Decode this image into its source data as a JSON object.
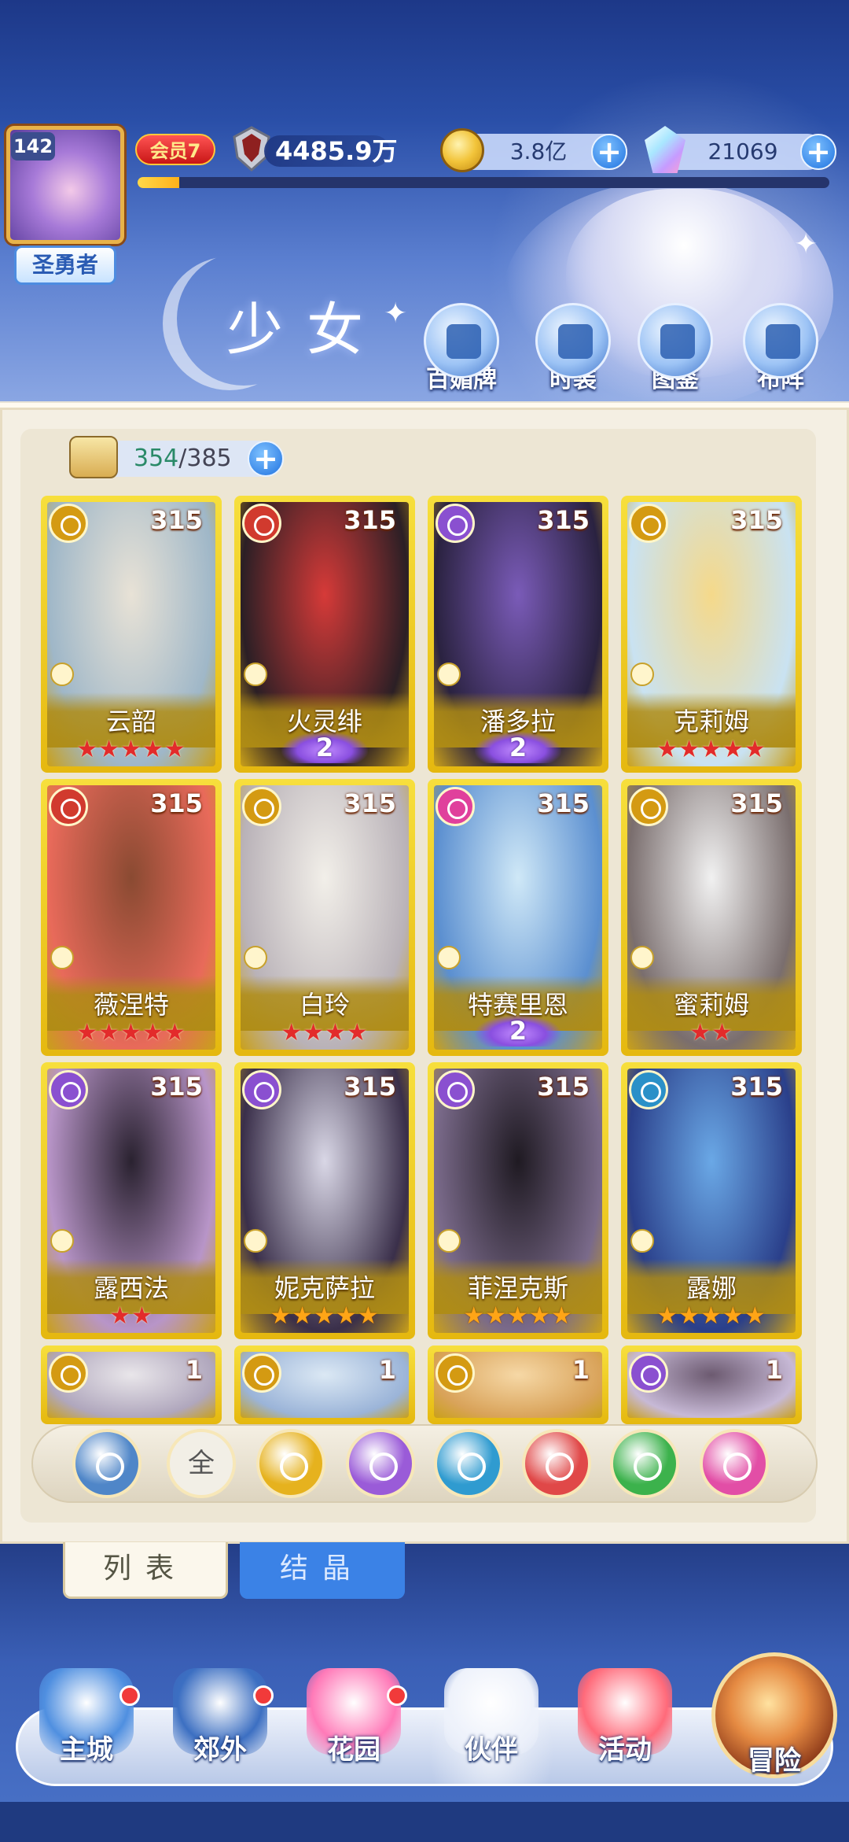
{
  "player": {
    "level": "142",
    "title": "圣勇者",
    "vip": "会员7",
    "power": "4485.9万",
    "exp_fraction": 0.06
  },
  "currency": {
    "gold": "3.8亿",
    "gems": "21069"
  },
  "section": {
    "title": "少女"
  },
  "features": [
    {
      "label": "百媚牌",
      "icon": "card-icon"
    },
    {
      "label": "时装",
      "icon": "outfit-icon"
    },
    {
      "label": "图鉴",
      "icon": "book-icon"
    },
    {
      "label": "布阵",
      "icon": "formation-grid-icon"
    }
  ],
  "roster": {
    "current": "354",
    "total": "385",
    "separator": "/"
  },
  "cards": [
    {
      "name": "云韶",
      "level": "315",
      "element": "light",
      "stars": "★★★★★",
      "star_color": "red"
    },
    {
      "name": "火灵绯",
      "level": "315",
      "element": "fire",
      "wing": "2"
    },
    {
      "name": "潘多拉",
      "level": "315",
      "element": "moon",
      "wing": "2"
    },
    {
      "name": "克莉姆",
      "level": "315",
      "element": "light",
      "stars": "★★★★★",
      "star_color": "red"
    },
    {
      "name": "薇涅特",
      "level": "315",
      "element": "fire",
      "stars": "★★★★★",
      "star_color": "red"
    },
    {
      "name": "白玲",
      "level": "315",
      "element": "light",
      "stars": "★★★★",
      "star_color": "red"
    },
    {
      "name": "特赛里恩",
      "level": "315",
      "element": "heart",
      "wing": "2"
    },
    {
      "name": "蜜莉姆",
      "level": "315",
      "element": "light",
      "stars": "★★",
      "star_color": "red"
    },
    {
      "name": "露西法",
      "level": "315",
      "element": "moon",
      "stars": "★★",
      "star_color": "red"
    },
    {
      "name": "妮克萨拉",
      "level": "315",
      "element": "moon",
      "stars": "★★★★★",
      "star_color": "gold"
    },
    {
      "name": "菲涅克斯",
      "level": "315",
      "element": "moon",
      "stars": "★★★★★",
      "star_color": "gold"
    },
    {
      "name": "露娜",
      "level": "315",
      "element": "water",
      "stars": "★★★★★",
      "star_color": "gold"
    },
    {
      "name": "",
      "level": "1",
      "element": "light"
    },
    {
      "name": "",
      "level": "1",
      "element": "light"
    },
    {
      "name": "",
      "level": "1",
      "element": "light"
    },
    {
      "name": "",
      "level": "1",
      "element": "moon"
    }
  ],
  "filters": [
    {
      "name": "special-filter",
      "color": "#4f86c8"
    },
    {
      "name": "all-filter",
      "label": "全"
    },
    {
      "name": "light-filter",
      "color": "#e6b21e"
    },
    {
      "name": "moon-filter",
      "color": "#9a5bd8"
    },
    {
      "name": "water-filter",
      "color": "#2f9bd0"
    },
    {
      "name": "fire-filter",
      "color": "#e04848"
    },
    {
      "name": "wind-filter",
      "color": "#3cb24c"
    },
    {
      "name": "heart-filter",
      "color": "#e24ea6"
    }
  ],
  "tabs": {
    "list": "列表",
    "crystal": "结晶"
  },
  "nav": [
    {
      "label": "主城",
      "dot": true
    },
    {
      "label": "郊外",
      "dot": true
    },
    {
      "label": "花园",
      "dot": true
    },
    {
      "label": "伙伴",
      "dot": false,
      "active": true
    },
    {
      "label": "活动",
      "dot": false
    }
  ],
  "adventure": "冒险",
  "colors": {
    "element": {
      "light": "#d49a12",
      "fire": "#d13a2e",
      "moon": "#8a50d0",
      "water": "#2a90c8",
      "heart": "#e0409c"
    }
  }
}
